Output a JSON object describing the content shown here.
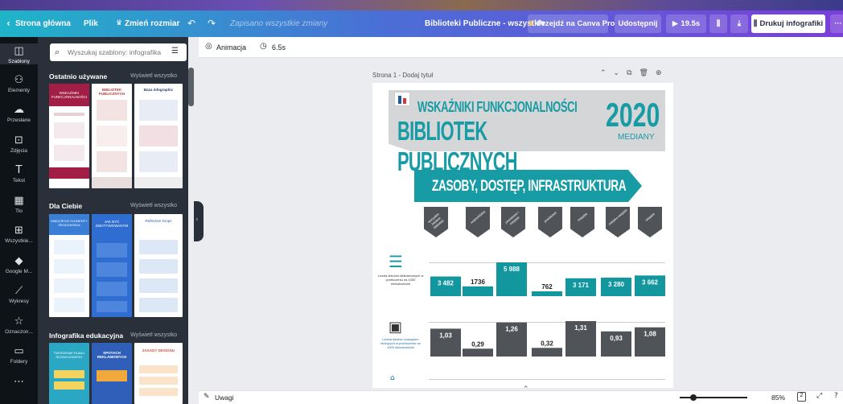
{
  "topbar": {
    "home": "Strona główna",
    "file": "Plik",
    "resize": "Zmień rozmiar",
    "saved": "Zapisano wszystkie zmiany",
    "doc_title": "Biblioteki Publiczne - wszystkie",
    "canva_pro": "Przejdź na Canva Pro",
    "share": "Udostępnij",
    "duration": "19.5s",
    "print": "Drukuj infografiki"
  },
  "rail": [
    {
      "icon": "templates-icon",
      "glyph": "◫",
      "label": "Szablony"
    },
    {
      "icon": "elements-icon",
      "glyph": "⚇",
      "label": "Elementy"
    },
    {
      "icon": "uploads-icon",
      "glyph": "☁",
      "label": "Przesłane"
    },
    {
      "icon": "photos-icon",
      "glyph": "⊡",
      "label": "Zdjęcia"
    },
    {
      "icon": "text-icon",
      "glyph": "T",
      "label": "Tekst"
    },
    {
      "icon": "background-icon",
      "glyph": "▦",
      "label": "Tło"
    },
    {
      "icon": "all-apps-icon",
      "glyph": "⊞",
      "label": "Wszystkie..."
    },
    {
      "icon": "google-maps-icon",
      "glyph": "◆",
      "label": "Google M..."
    },
    {
      "icon": "charts-icon",
      "glyph": "⟋",
      "label": "Wykresy"
    },
    {
      "icon": "starred-icon",
      "glyph": "☆",
      "label": "Oznaczon..."
    },
    {
      "icon": "folders-icon",
      "glyph": "▭",
      "label": "Foldery"
    },
    {
      "icon": "more-icon",
      "glyph": "⋯",
      "label": ""
    }
  ],
  "panel": {
    "search_placeholder": "Wyszukaj szablony: infografika",
    "sections": [
      {
        "title": "Ostatnio używane",
        "see_all": "Wyświetl wszystko"
      },
      {
        "title": "Dla Ciebie",
        "see_all": "Wyświetl wszystko"
      },
      {
        "title": "Infografika edukacyjna",
        "see_all": "Wyświetl wszystko"
      }
    ],
    "recent_thumbs": [
      "WSKAŹNIKI FUNKCJONALNOŚCI",
      "BIBLIOTEK PUBLICZNYCH",
      "Baza Infographic"
    ],
    "foryou_thumbs": [
      "MIĘDZIECIE ELEMENTY ŚRODOWISKA",
      "JAK BYĆ ZMOTYWOWANYM",
      "Reflective Drops"
    ],
    "edu_thumbs": [
      "TWORZENIE PLANU ROZWOJOWEGO",
      "SPOTACH REKLAMOWYCH",
      "ZASADY DESIGNU"
    ]
  },
  "subbar": {
    "animation": "Animacja",
    "time": "6.5s"
  },
  "page": {
    "label": "Strona 1 - Dodaj tytuł"
  },
  "infographic": {
    "title_line1": "WSKAŹNIKI FUNKCJONALNOŚCI",
    "title_line2": "BIBLIOTEK PUBLICZNYCH",
    "year": "2020",
    "median": "MEDIANY",
    "banner": "ZASOBY, DOSTĘP, INFRASTRUKTURA",
    "categories": [
      "wszystkie badane biblioteki",
      "wojewódzkie",
      "powiatowe i miejskie",
      "powiatowe",
      "miejskie",
      "miejsko-wiejskie",
      "wiejskie"
    ],
    "row1_label": "Liczba zbiorów bibliotecznych w przeliczeniu na 1000 mieszkańców",
    "row1_values": [
      "3 482",
      "1736",
      "5 988",
      "762",
      "3 171",
      "3 280",
      "3 662"
    ],
    "row2_label": "Liczba tytułów czasopism bieżących w przeliczeniu na 1000 mieszkańców",
    "row2_values": [
      "1,03",
      "0,29",
      "1,26",
      "0,32",
      "1,31",
      "0,93",
      "1,08"
    ],
    "colors": {
      "teal": "#12979f",
      "gray": "#505357",
      "banner": "#179ba4"
    }
  },
  "bottom": {
    "notes": "Uwagi",
    "zoom": "85%",
    "page_count": "2"
  }
}
